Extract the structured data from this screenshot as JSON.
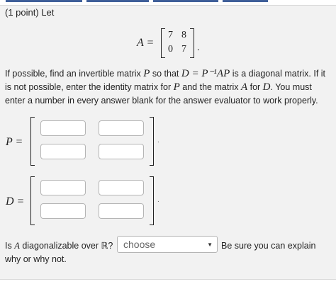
{
  "header": {
    "points": "(1 point) Let"
  },
  "matrix_A": {
    "lhs": "A =",
    "rows": [
      [
        "7",
        "8"
      ],
      [
        "0",
        "7"
      ]
    ],
    "trailing": "."
  },
  "instructions": {
    "part1": "If possible, find an invertible matrix ",
    "P": "P",
    "part2": " so that ",
    "eq": "D = P⁻¹AP",
    "part3": " is a diagonal matrix. If it is not possible, enter the identity matrix for ",
    "P2": "P",
    "part4": " and the matrix ",
    "A": "A",
    "part5": " for ",
    "D": "D",
    "part6": ". You must enter a number in every answer blank for the answer evaluator to work properly."
  },
  "P_matrix": {
    "label": "P =",
    "values": [
      "",
      "",
      "",
      ""
    ]
  },
  "D_matrix": {
    "label": "D =",
    "values": [
      "",
      "",
      "",
      ""
    ]
  },
  "question": {
    "text_before": "Is ",
    "A": "A",
    "text_mid": " diagonalizable over ",
    "R": "ℝ",
    "q": "?",
    "select_value": "choose",
    "text_after": "Be sure you can explain",
    "text_after2": "why or why not."
  }
}
